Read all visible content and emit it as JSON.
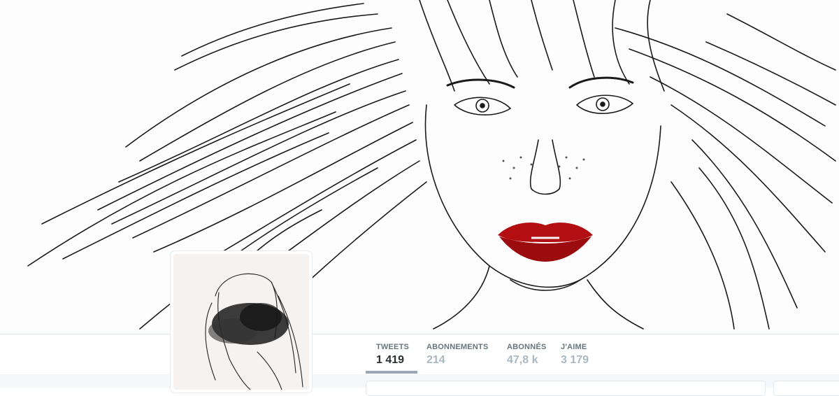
{
  "profile": {
    "banner_image": "line-drawing portrait of a woman with long flowing hair and red lips",
    "avatar_image": "sketch of a woman's profile with dark ink smudge over the face",
    "accent_color": "#b30f12"
  },
  "stats": [
    {
      "key": "tweets",
      "label": "TWEETS",
      "value": "1 419",
      "active": true
    },
    {
      "key": "following",
      "label": "ABONNEMENTS",
      "value": "214",
      "active": false
    },
    {
      "key": "followers",
      "label": "ABONNÉS",
      "value": "47,8 k",
      "active": false
    },
    {
      "key": "likes",
      "label": "J'AIME",
      "value": "3 179",
      "active": false
    }
  ]
}
